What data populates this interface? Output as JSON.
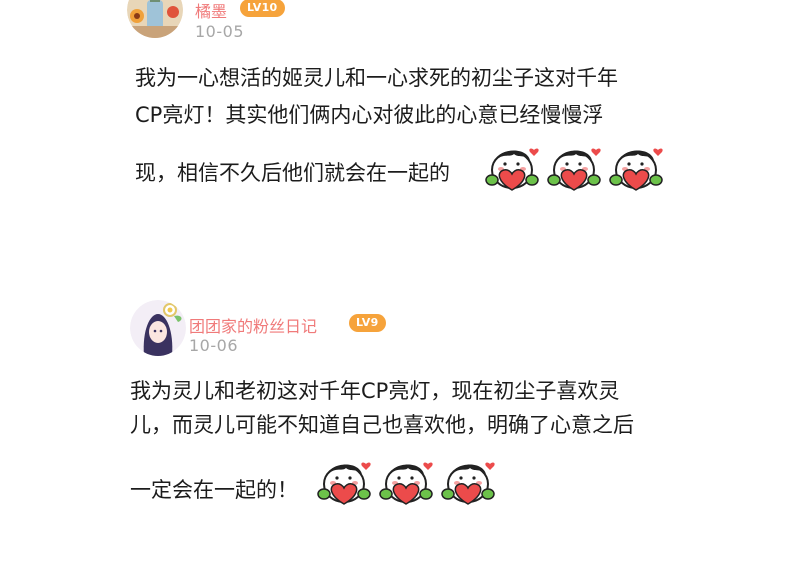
{
  "comments": [
    {
      "username": "橘墨",
      "level": "LV10",
      "date": "10-05",
      "lines": [
        "我为一心想活的姬灵儿和一心求死的初尘子这对千年",
        "CP亮灯！其实他们俩内心对彼此的心意已经慢慢浮",
        "现，相信不久后他们就会在一起的"
      ],
      "emoji": [
        "heart-hug-emoji",
        "heart-hug-emoji",
        "heart-hug-emoji"
      ]
    },
    {
      "username": "团团家的粉丝日记",
      "level": "LV9",
      "date": "10-06",
      "lines": [
        "我为灵儿和老初这对千年CP亮灯，现在初尘子喜欢灵",
        "儿，而灵儿可能不知道自己也喜欢他，明确了心意之后",
        "一定会在一起的！"
      ],
      "emoji": [
        "heart-hug-emoji",
        "heart-hug-emoji",
        "heart-hug-emoji"
      ]
    }
  ],
  "colors": {
    "username": "#f07a7a",
    "badge": "#f6a33b",
    "date": "#a7a7a7",
    "text": "#1c1c1c"
  }
}
